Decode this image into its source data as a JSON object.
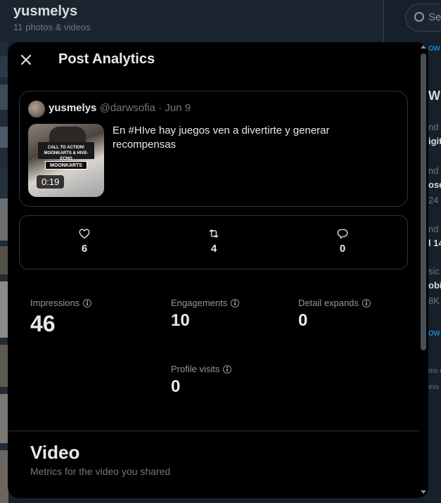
{
  "background": {
    "profile_name": "yusmelys",
    "profile_sub": "11 photos & videos",
    "search_placeholder": "Se",
    "right_fragments": [
      "ow",
      "Wha",
      "nd",
      "igit",
      "nd",
      "ose",
      "24",
      "nd",
      "l 14",
      "sic",
      "obi",
      "8K",
      "ow",
      "ms c",
      "ess"
    ]
  },
  "modal": {
    "title": "Post Analytics",
    "close_icon": "close-icon"
  },
  "post": {
    "author_name": "yusmelys",
    "author_handle": "@darwsofia",
    "separator": " · ",
    "date": "Jun 9",
    "text": "En #HIve hay juegos ven a divertirte y generar recompensas",
    "video_duration": "0:19",
    "thumb_banner": "CALL TO ACTION! MOONKARTS & HIVE-ECHO",
    "thumb_tag": "MOONKARTS"
  },
  "engagement": {
    "likes": "6",
    "reposts": "4",
    "replies": "0",
    "icons": [
      "heart-icon",
      "repost-icon",
      "reply-icon"
    ]
  },
  "metrics": {
    "impressions_label": "Impressions",
    "impressions_value": "46",
    "engagements_label": "Engagements",
    "engagements_value": "10",
    "detail_expands_label": "Detail expands",
    "detail_expands_value": "0",
    "profile_visits_label": "Profile visits",
    "profile_visits_value": "0"
  },
  "video_section": {
    "title": "Video",
    "subtitle": "Metrics for the video you shared"
  },
  "colors": {
    "modal_bg": "#000000",
    "page_bg": "#15202b",
    "text_primary": "#e7e9ea",
    "text_secondary": "#71767b",
    "border": "#2f3336",
    "link": "#1d9bf0"
  }
}
